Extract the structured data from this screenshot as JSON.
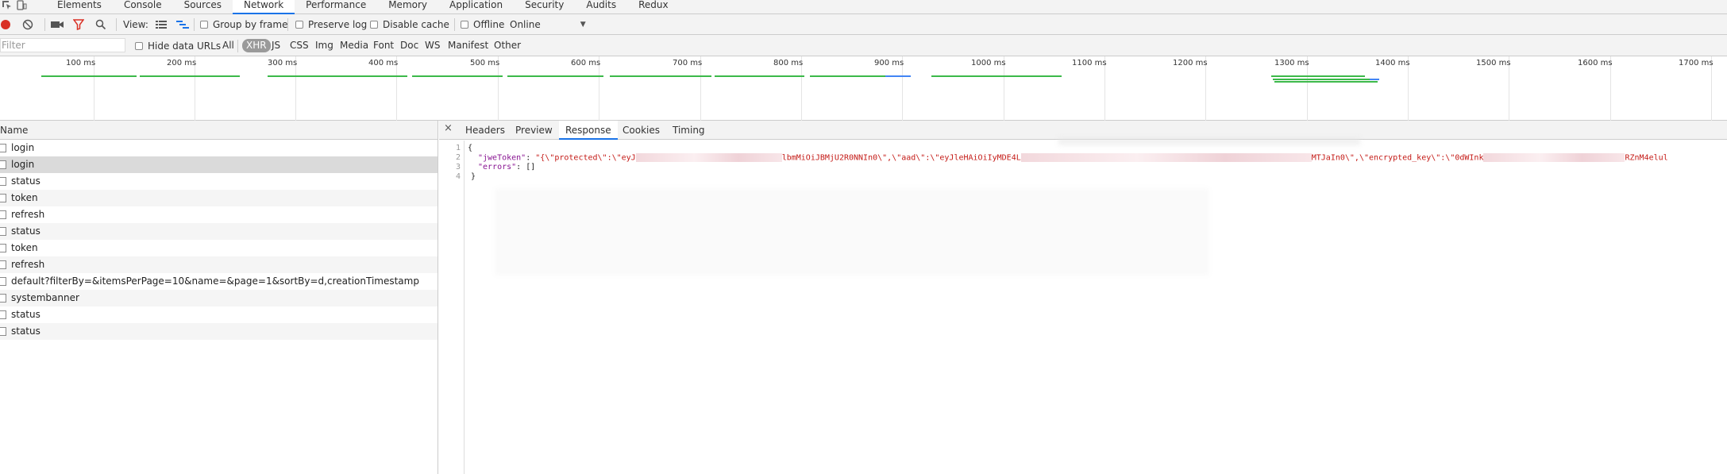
{
  "tabbar": {
    "tabs": [
      "Elements",
      "Console",
      "Sources",
      "Network",
      "Performance",
      "Memory",
      "Application",
      "Security",
      "Audits",
      "Redux"
    ],
    "active_tab": "Network"
  },
  "toolbar": {
    "view_label": "View:",
    "group_by_frame": "Group by frame",
    "preserve_log": "Preserve log",
    "disable_cache": "Disable cache",
    "offline": "Offline",
    "throttle_value": "Online"
  },
  "filterbar": {
    "filter_placeholder": "Filter",
    "hide_data_urls": "Hide data URLs",
    "types": [
      "All",
      "XHR",
      "JS",
      "CSS",
      "Img",
      "Media",
      "Font",
      "Doc",
      "WS",
      "Manifest",
      "Other"
    ],
    "active_type": "XHR"
  },
  "overview": {
    "ticks": [
      "100 ms",
      "200 ms",
      "300 ms",
      "400 ms",
      "500 ms",
      "600 ms",
      "700 ms",
      "800 ms",
      "900 ms",
      "1000 ms",
      "1100 ms",
      "1200 ms",
      "1300 ms",
      "1400 ms",
      "1500 ms",
      "1600 ms",
      "1700 ms"
    ]
  },
  "requests": {
    "column_header": "Name",
    "rows": [
      "login",
      "login",
      "status",
      "token",
      "refresh",
      "status",
      "token",
      "refresh",
      "default?filterBy=&itemsPerPage=10&name=&page=1&sortBy=d,creationTimestamp",
      "systembanner",
      "status",
      "status"
    ],
    "selected_index": 1
  },
  "detail": {
    "close": "×",
    "tabs": [
      "Headers",
      "Preview",
      "Response",
      "Cookies",
      "Timing"
    ],
    "active_tab": "Response",
    "line_numbers": [
      "1",
      "2",
      "3",
      "4"
    ],
    "response": {
      "open_brace": "{",
      "jwe_key": "\"jweToken\"",
      "jwe_prefix": "\"{\\\"protected\\\":\\\"eyJ",
      "jwe_mid1": "lbmMiOiJBMjU2R0NNIn0\\\",\\\"aad\\\":\\\"eyJleHAiOiIyMDE4L",
      "jwe_mid2": "MTJaIn0\\\",\\\"encrypted_key\\\":\\\"0dWInk",
      "jwe_tail": "RZnM4elul",
      "errors_key": "\"errors\"",
      "errors_value": "[]",
      "close_brace": "}"
    }
  },
  "colors": {
    "accent": "#1a73e8",
    "record": "#d93025",
    "filter_active": "#d93025",
    "timeline_bar": "#3cb94a"
  }
}
